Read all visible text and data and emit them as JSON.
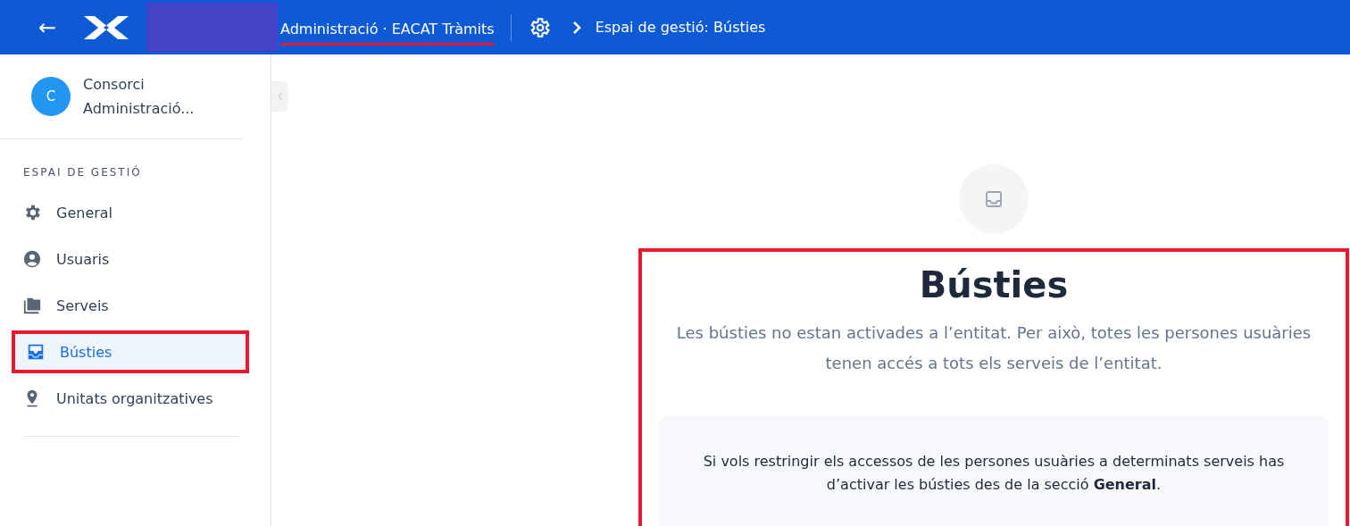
{
  "header": {
    "back": "←",
    "app_title": "Administració · EACAT Tràmits",
    "title_underlined": true,
    "breadcrumb": "Espai de gestió: Bústies"
  },
  "sidebar": {
    "account": {
      "initial": "C",
      "name_line1": "Consorci",
      "name_line2": "Administració..."
    },
    "section_title": "ESPAI DE GESTIÓ",
    "items": [
      {
        "label": "General",
        "selected": false,
        "highlighted": false
      },
      {
        "label": "Usuaris",
        "selected": false,
        "highlighted": false
      },
      {
        "label": "Serveis",
        "selected": false,
        "highlighted": false
      },
      {
        "label": "Bústies",
        "selected": true,
        "highlighted": true
      },
      {
        "label": "Unitats organitzatives",
        "selected": false,
        "highlighted": false
      }
    ]
  },
  "main": {
    "highlighted": true,
    "title": "Bústies",
    "description": "Les bústies no estan activades a l’entitat. Per això, totes les persones usuàries tenen accés a tots els serveis de l’entitat.",
    "notice": "Si vols restringir els accessos de les persones usuàries a determinats serveis has d’activar les bústies des de la secció **General**."
  }
}
